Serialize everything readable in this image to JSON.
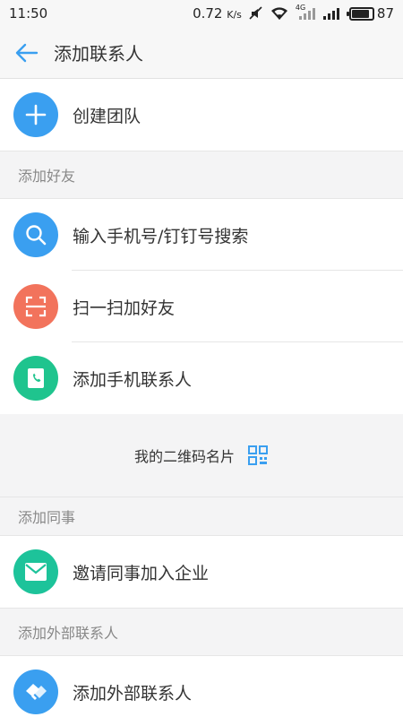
{
  "status_bar": {
    "time": "11:50",
    "speed": "0.72",
    "speed_unit": "K/s",
    "network_tag": "4G",
    "battery": "87"
  },
  "header": {
    "title": "添加联系人"
  },
  "create_team": {
    "label": "创建团队"
  },
  "section_friends": {
    "title": "添加好友",
    "items": [
      {
        "label": "输入手机号/钉钉号搜索"
      },
      {
        "label": "扫一扫加好友"
      },
      {
        "label": "添加手机联系人"
      }
    ]
  },
  "qr_card": {
    "label": "我的二维码名片"
  },
  "section_colleagues": {
    "title": "添加同事",
    "items": [
      {
        "label": "邀请同事加入企业"
      }
    ]
  },
  "section_external": {
    "title": "添加外部联系人",
    "items": [
      {
        "label": "添加外部联系人"
      }
    ]
  },
  "colors": {
    "blue": "#3a9ff0",
    "red": "#f2735c",
    "green": "#1fc48e",
    "accent_link": "#3a9ff0"
  }
}
